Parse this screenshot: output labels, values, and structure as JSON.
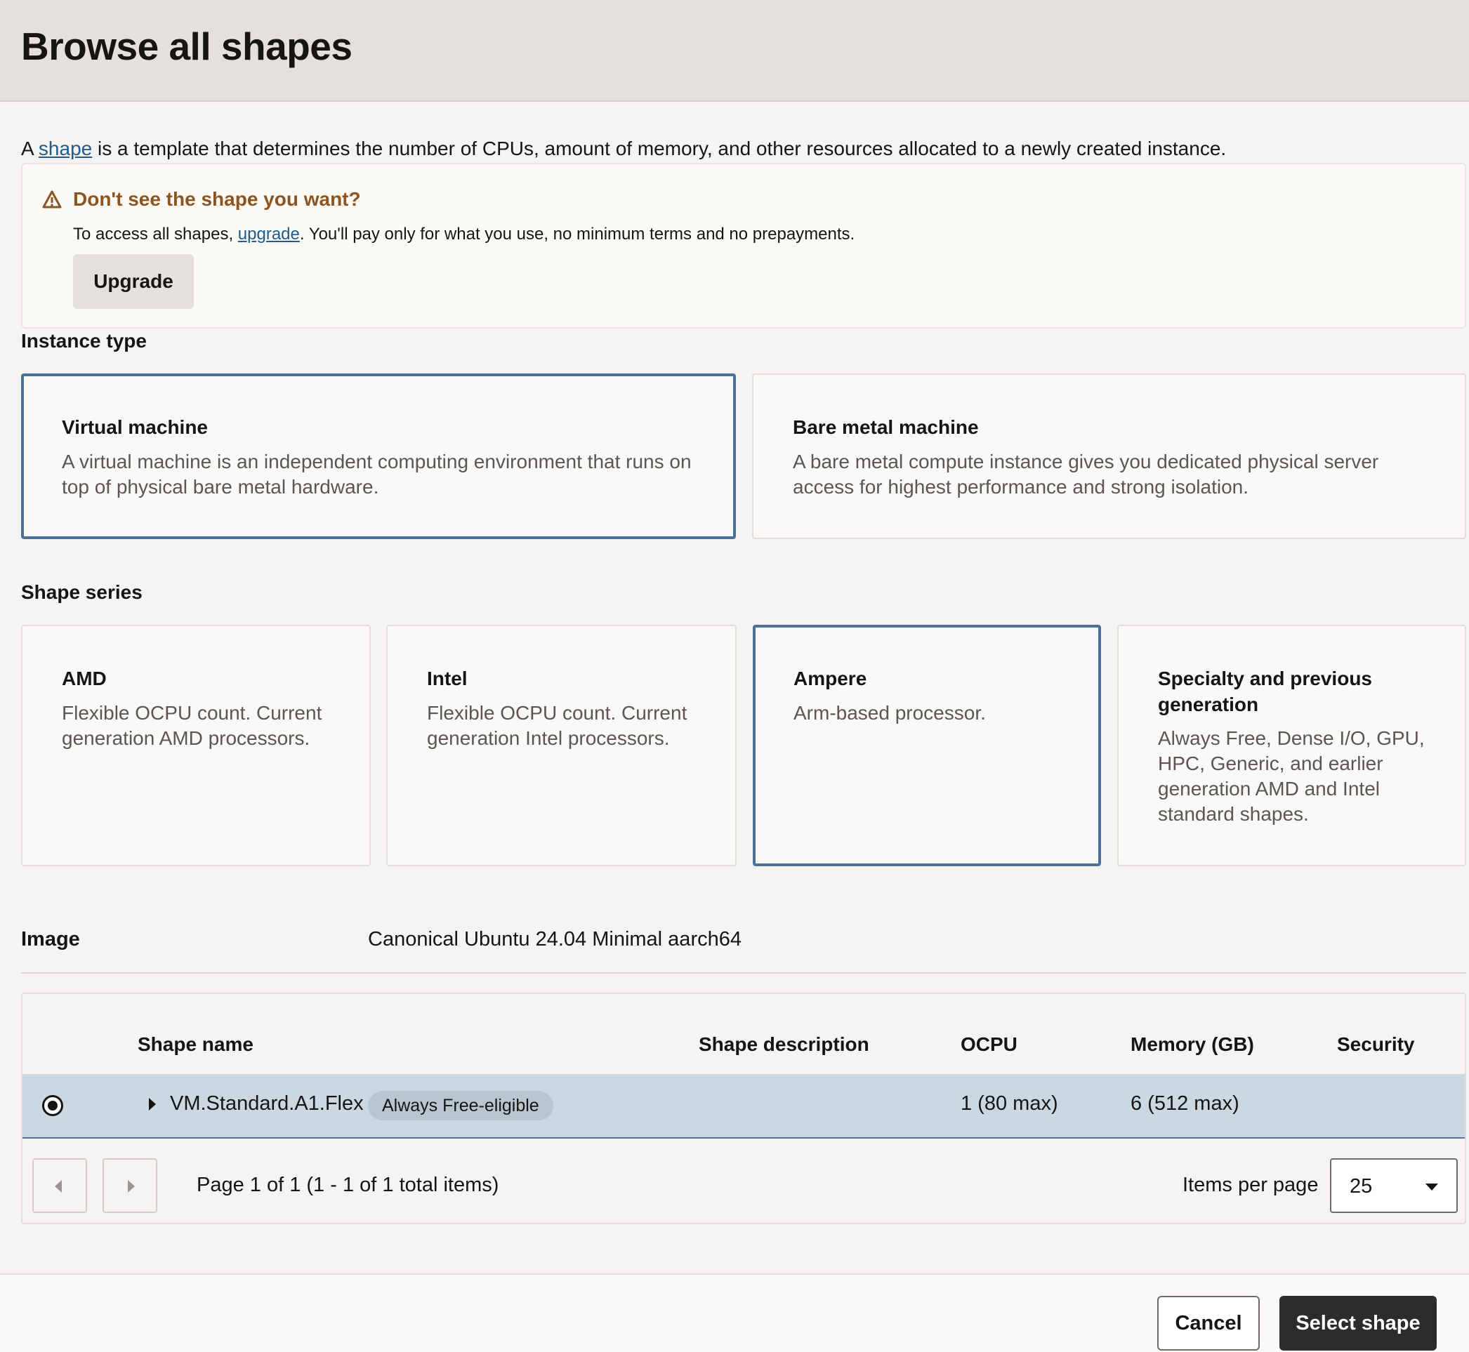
{
  "header": {
    "title": "Browse all shapes"
  },
  "intro": {
    "prefix": "A ",
    "link": "shape",
    "suffix": " is a template that determines the number of CPUs, amount of memory, and other resources allocated to a newly created instance."
  },
  "notice": {
    "icon": "warning-icon",
    "title": "Don't see the shape you want?",
    "body_prefix": "To access all shapes, ",
    "body_link": "upgrade",
    "body_suffix": ". You'll pay only for what you use, no minimum terms and no prepayments.",
    "button": "Upgrade"
  },
  "instance_type": {
    "label": "Instance type",
    "options": [
      {
        "title": "Virtual machine",
        "desc": "A virtual machine is an independent computing environment that runs on top of physical bare metal hardware.",
        "selected": true
      },
      {
        "title": "Bare metal machine",
        "desc": "A bare metal compute instance gives you dedicated physical server access for highest performance and strong isolation.",
        "selected": false
      }
    ]
  },
  "shape_series": {
    "label": "Shape series",
    "options": [
      {
        "title": "AMD",
        "desc": "Flexible OCPU count. Current generation AMD processors.",
        "selected": false
      },
      {
        "title": "Intel",
        "desc": "Flexible OCPU count. Current generation Intel processors.",
        "selected": false
      },
      {
        "title": "Ampere",
        "desc": "Arm-based processor.",
        "selected": true
      },
      {
        "title": "Specialty and previous generation",
        "desc": "Always Free, Dense I/O, GPU, HPC, Generic, and earlier generation AMD and Intel standard shapes.",
        "selected": false
      }
    ]
  },
  "image": {
    "label": "Image",
    "value": "Canonical Ubuntu 24.04 Minimal aarch64"
  },
  "table": {
    "columns": [
      "Shape name",
      "Shape description",
      "OCPU",
      "Memory (GB)",
      "Security"
    ],
    "rows": [
      {
        "name": "VM.Standard.A1.Flex",
        "badge": "Always Free-eligible",
        "description": "",
        "ocpu": "1 (80 max)",
        "memory": "6 (512 max)",
        "security": "",
        "selected": true
      }
    ]
  },
  "pagination": {
    "info": "Page 1 of 1 (1 - 1 of 1 total items)",
    "items_per_page_label": "Items per page",
    "items_per_page_value": "25"
  },
  "footer": {
    "cancel": "Cancel",
    "select": "Select shape"
  },
  "colors": {
    "accent": "#4c7395",
    "warning": "#8a5522",
    "selected_row": "#ccd8e1"
  }
}
